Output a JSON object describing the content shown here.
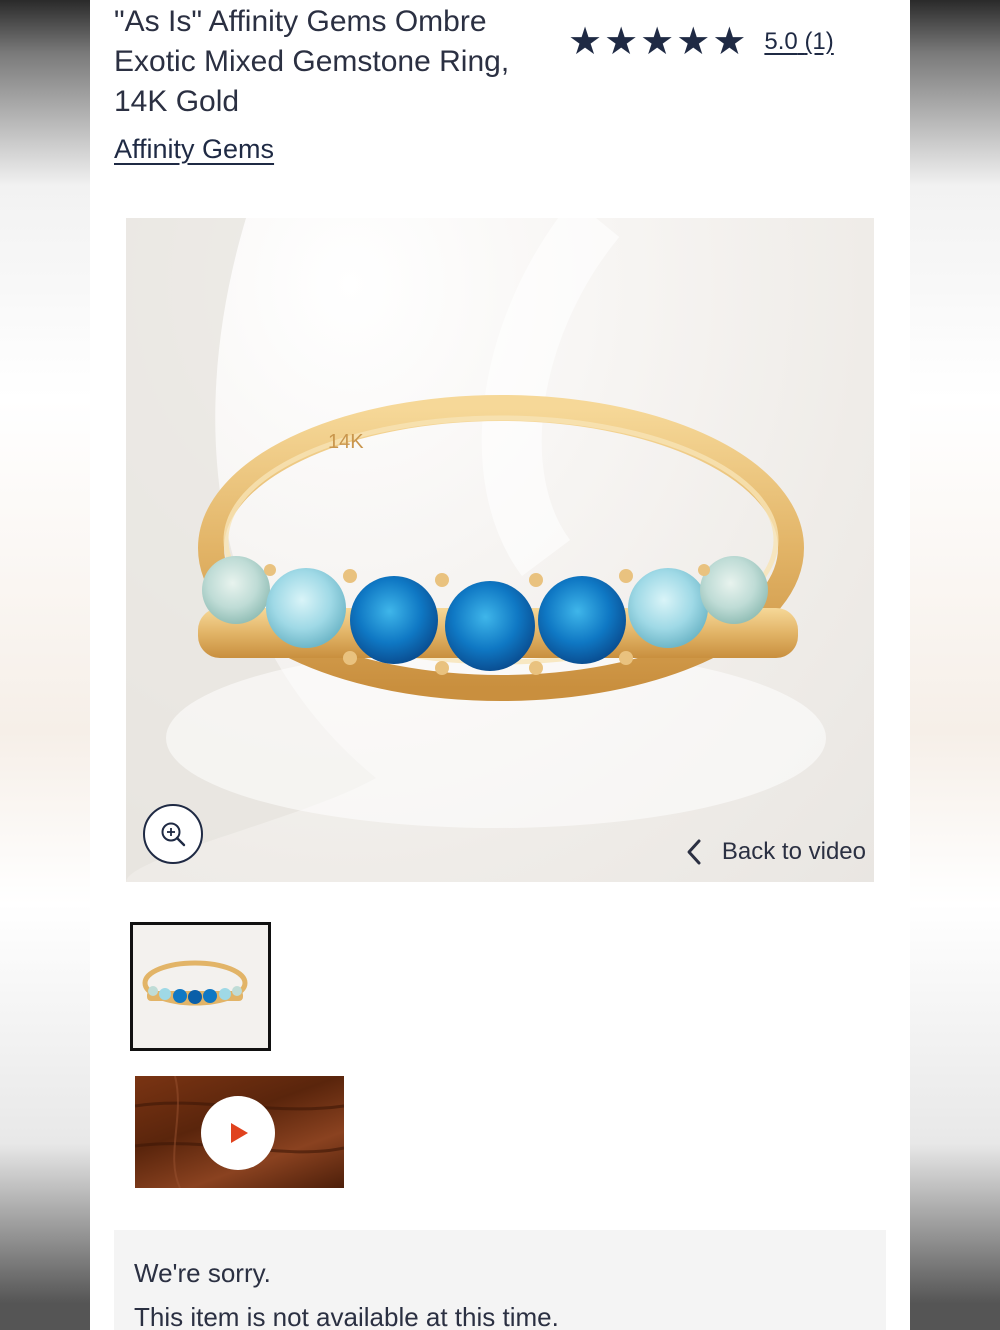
{
  "product": {
    "title": "\"As Is\" Affinity Gems Ombre Exotic Mixed Gemstone Ring, 14K Gold",
    "brand": "Affinity Gems",
    "rating": {
      "stars": 5,
      "value_label": "5.0",
      "count_label": "(1)"
    }
  },
  "gallery": {
    "back_to_video_label": "Back to video",
    "ring_engraving": "14K",
    "icons": {
      "zoom": "zoom-in-icon",
      "back": "chevron-left-icon",
      "play": "play-icon"
    }
  },
  "availability": {
    "line1": "We're sorry.",
    "line2": "This item is not available at this time."
  },
  "colors": {
    "text": "#1f2a44",
    "play": "#e0421e"
  }
}
